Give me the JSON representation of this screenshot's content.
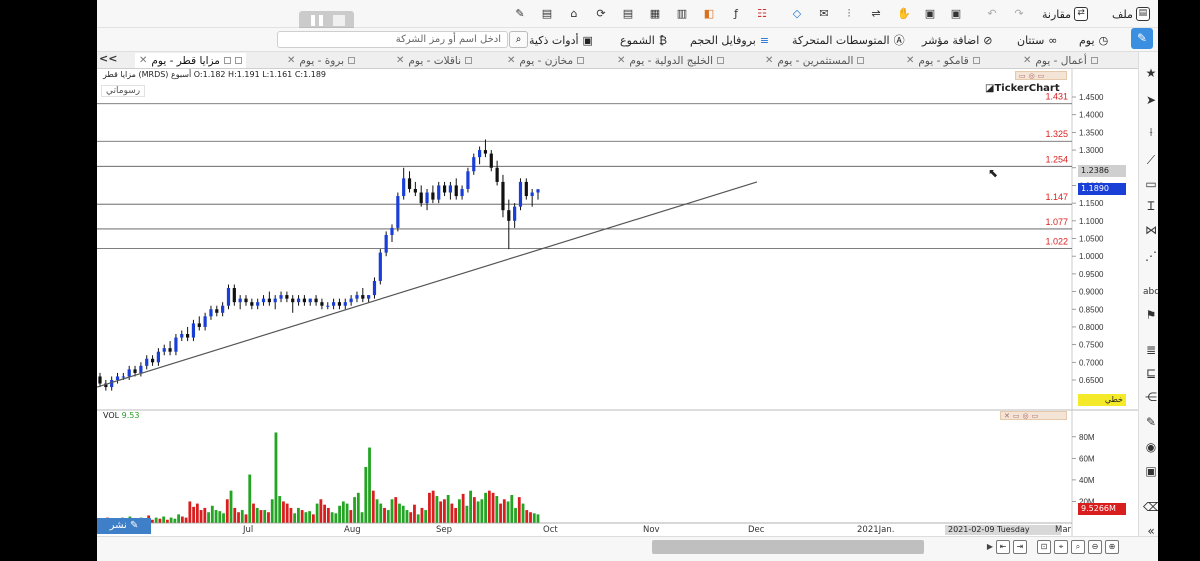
{
  "toolbar": {
    "file": "ملف",
    "compare": "مقارنة",
    "day": "يوم",
    "fifties": "ستتان",
    "add_indicator": "اضافة مؤشر",
    "moving_averages": "المتوسطات المتحركة",
    "volume_profile": "بروفايل الحجم",
    "candles": "الشموع",
    "smart_tools": "أدوات ذكية",
    "search_placeholder": "ادخل اسم أو رمز الشركة"
  },
  "tabs": [
    {
      "label": "مزايا قطر - يوم",
      "active": true
    },
    {
      "label": "بروة - يوم"
    },
    {
      "label": "ناقلات - يوم"
    },
    {
      "label": "مخازن - يوم"
    },
    {
      "label": "الخليج الدولية - يوم"
    },
    {
      "label": "المستثمرين - يوم"
    },
    {
      "label": "قامكو - يوم"
    },
    {
      "label": "أعمال - يوم"
    }
  ],
  "chart_info": {
    "symbol_line": "مزايا قطر (MRDS) أسبوع O:1.182 H:1.191 L:1.161 C:1.189",
    "drawings_label": "رسوماتي",
    "logo": "TickerChart",
    "current_price": "1.1890",
    "crosshair_price": "1.2386",
    "line_type_label": "خطي",
    "vol_label": "VOL",
    "vol_value": "9.53",
    "vol_current": "9.5266M",
    "publish_label": "نشر",
    "date_label": "2021-02-09 Tuesday",
    "colors": {
      "up": "#1a3fd6",
      "down": "#111111",
      "vol_up": "#23a423",
      "vol_down": "#d81e1e",
      "level": "#d81e1e",
      "current": "#1a3fd6",
      "yellow": "#f5ea2a"
    }
  },
  "chart_data": [
    {
      "type": "candlestick",
      "title": "مزايا قطر (MRDS)",
      "x_ticks": [
        "Jul",
        "Aug",
        "Sep",
        "Oct",
        "Nov",
        "Dec",
        "2021Jan.",
        "Mar"
      ],
      "y_ticks": [
        "1.4500",
        "1.4000",
        "1.3500",
        "1.3000",
        "1.2500",
        "1.2000",
        "1.1500",
        "1.1000",
        "1.0500",
        "1.0000",
        "0.9500",
        "0.9000",
        "0.8500",
        "0.8000",
        "0.7500",
        "0.7000",
        "0.6500"
      ],
      "ylim": [
        0.61,
        1.47
      ],
      "levels": [
        "1.431",
        "1.325",
        "1.254",
        "1.147",
        "1.077",
        "1.022"
      ],
      "trendline": [
        {
          "date": "Jun",
          "value": 0.63
        },
        {
          "date": "Dec",
          "value": 1.21
        }
      ],
      "ohlc": [
        [
          0.66,
          0.67,
          0.63,
          0.64
        ],
        [
          0.64,
          0.65,
          0.62,
          0.63
        ],
        [
          0.63,
          0.66,
          0.62,
          0.65
        ],
        [
          0.65,
          0.67,
          0.64,
          0.66
        ],
        [
          0.66,
          0.67,
          0.65,
          0.66
        ],
        [
          0.66,
          0.69,
          0.65,
          0.68
        ],
        [
          0.68,
          0.69,
          0.66,
          0.67
        ],
        [
          0.67,
          0.7,
          0.66,
          0.69
        ],
        [
          0.69,
          0.72,
          0.68,
          0.71
        ],
        [
          0.71,
          0.72,
          0.69,
          0.7
        ],
        [
          0.7,
          0.74,
          0.69,
          0.73
        ],
        [
          0.73,
          0.75,
          0.72,
          0.74
        ],
        [
          0.74,
          0.76,
          0.72,
          0.73
        ],
        [
          0.73,
          0.78,
          0.72,
          0.77
        ],
        [
          0.77,
          0.79,
          0.76,
          0.78
        ],
        [
          0.78,
          0.8,
          0.76,
          0.77
        ],
        [
          0.77,
          0.82,
          0.76,
          0.81
        ],
        [
          0.81,
          0.83,
          0.79,
          0.8
        ],
        [
          0.8,
          0.84,
          0.79,
          0.83
        ],
        [
          0.83,
          0.86,
          0.82,
          0.85
        ],
        [
          0.85,
          0.86,
          0.83,
          0.84
        ],
        [
          0.84,
          0.87,
          0.83,
          0.86
        ],
        [
          0.86,
          0.92,
          0.85,
          0.91
        ],
        [
          0.91,
          0.92,
          0.86,
          0.87
        ],
        [
          0.87,
          0.89,
          0.85,
          0.88
        ],
        [
          0.88,
          0.89,
          0.86,
          0.87
        ],
        [
          0.87,
          0.88,
          0.85,
          0.86
        ],
        [
          0.86,
          0.88,
          0.85,
          0.87
        ],
        [
          0.87,
          0.89,
          0.86,
          0.88
        ],
        [
          0.88,
          0.9,
          0.86,
          0.87
        ],
        [
          0.87,
          0.89,
          0.85,
          0.88
        ],
        [
          0.88,
          0.9,
          0.87,
          0.89
        ],
        [
          0.89,
          0.9,
          0.87,
          0.88
        ],
        [
          0.88,
          0.89,
          0.84,
          0.87
        ],
        [
          0.87,
          0.89,
          0.86,
          0.88
        ],
        [
          0.88,
          0.89,
          0.86,
          0.87
        ],
        [
          0.87,
          0.88,
          0.86,
          0.88
        ],
        [
          0.88,
          0.89,
          0.86,
          0.87
        ],
        [
          0.87,
          0.88,
          0.85,
          0.86
        ],
        [
          0.86,
          0.87,
          0.85,
          0.86
        ],
        [
          0.86,
          0.88,
          0.85,
          0.87
        ],
        [
          0.87,
          0.88,
          0.85,
          0.86
        ],
        [
          0.86,
          0.88,
          0.85,
          0.87
        ],
        [
          0.87,
          0.89,
          0.86,
          0.88
        ],
        [
          0.88,
          0.9,
          0.87,
          0.89
        ],
        [
          0.89,
          0.91,
          0.87,
          0.88
        ],
        [
          0.88,
          0.89,
          0.87,
          0.89
        ],
        [
          0.89,
          0.94,
          0.88,
          0.93
        ],
        [
          0.93,
          1.02,
          0.92,
          1.01
        ],
        [
          1.01,
          1.07,
          1.0,
          1.06
        ],
        [
          1.06,
          1.09,
          1.04,
          1.08
        ],
        [
          1.08,
          1.18,
          1.07,
          1.17
        ],
        [
          1.17,
          1.25,
          1.16,
          1.22
        ],
        [
          1.22,
          1.24,
          1.18,
          1.19
        ],
        [
          1.19,
          1.21,
          1.17,
          1.18
        ],
        [
          1.18,
          1.2,
          1.14,
          1.15
        ],
        [
          1.15,
          1.19,
          1.13,
          1.18
        ],
        [
          1.18,
          1.2,
          1.15,
          1.16
        ],
        [
          1.16,
          1.21,
          1.15,
          1.2
        ],
        [
          1.2,
          1.21,
          1.17,
          1.18
        ],
        [
          1.18,
          1.21,
          1.16,
          1.2
        ],
        [
          1.2,
          1.22,
          1.16,
          1.17
        ],
        [
          1.17,
          1.2,
          1.16,
          1.19
        ],
        [
          1.19,
          1.25,
          1.18,
          1.24
        ],
        [
          1.24,
          1.29,
          1.23,
          1.28
        ],
        [
          1.28,
          1.31,
          1.26,
          1.3
        ],
        [
          1.3,
          1.33,
          1.28,
          1.29
        ],
        [
          1.29,
          1.3,
          1.24,
          1.25
        ],
        [
          1.25,
          1.27,
          1.2,
          1.21
        ],
        [
          1.21,
          1.23,
          1.11,
          1.13
        ],
        [
          1.13,
          1.16,
          1.02,
          1.1
        ],
        [
          1.1,
          1.15,
          1.08,
          1.14
        ],
        [
          1.14,
          1.22,
          1.13,
          1.21
        ],
        [
          1.21,
          1.22,
          1.16,
          1.17
        ],
        [
          1.17,
          1.19,
          1.14,
          1.18
        ],
        [
          1.18,
          1.19,
          1.16,
          1.189
        ]
      ],
      "volume": [
        4,
        3,
        5,
        3,
        4,
        2,
        5,
        3,
        6,
        4,
        3,
        5,
        4,
        7,
        3,
        5,
        4,
        6,
        3,
        5,
        4,
        8,
        6,
        5,
        20,
        15,
        18,
        12,
        14,
        10,
        16,
        12,
        11,
        9,
        22,
        30,
        14,
        10,
        12,
        8,
        45,
        18,
        14,
        12,
        12,
        10,
        22,
        84,
        25,
        20,
        18,
        14,
        9,
        14,
        12,
        10,
        11,
        8,
        18,
        22,
        17,
        14,
        10,
        9,
        16,
        20,
        18,
        12,
        24,
        28,
        10,
        52,
        70,
        30,
        22,
        18,
        14,
        12,
        22,
        24,
        18,
        16,
        12,
        10,
        17,
        8,
        14,
        12,
        28,
        30,
        25,
        20,
        22,
        26,
        18,
        14,
        22,
        27,
        16,
        30,
        24,
        20,
        22,
        28,
        30,
        28,
        25,
        18,
        22,
        20,
        26,
        14,
        24,
        18,
        12,
        10,
        9,
        8
      ],
      "vol_ticks": [
        "80M",
        "60M",
        "40M",
        "20M"
      ]
    }
  ]
}
